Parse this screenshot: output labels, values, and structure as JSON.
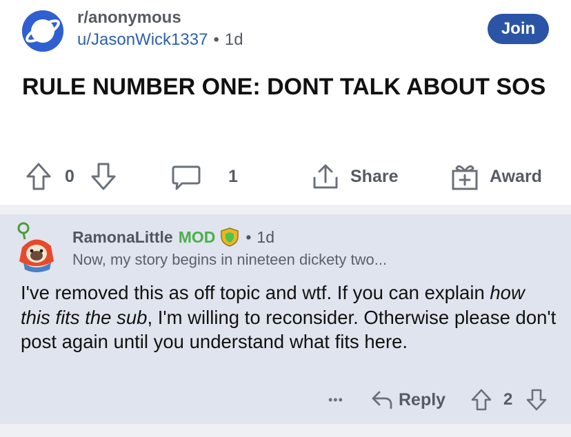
{
  "post": {
    "subreddit": "r/anonymous",
    "author": "u/JasonWick1337",
    "separator": "•",
    "age": "1d",
    "join_label": "Join",
    "title": "RULE NUMBER ONE: DONT TALK ABOUT SOS",
    "votes": "0",
    "comments": "1",
    "share_label": "Share",
    "award_label": "Award"
  },
  "comment": {
    "author": "RamonaLittle",
    "mod_badge": "MOD",
    "separator": "•",
    "age": "1d",
    "flair": "Now, my story begins in nineteen dickety two...",
    "body_part1": "I've removed this as off topic and wtf. If you can explain ",
    "body_em": "how this fits the sub",
    "body_part2": ", I'm willing to reconsider. Otherwise please don't post again until you understand what fits here.",
    "more": "•••",
    "reply_label": "Reply",
    "votes": "2"
  },
  "colors": {
    "accent": "#2c54a6",
    "mod": "#49b04a",
    "comment_bg": "#dfe4ee"
  }
}
